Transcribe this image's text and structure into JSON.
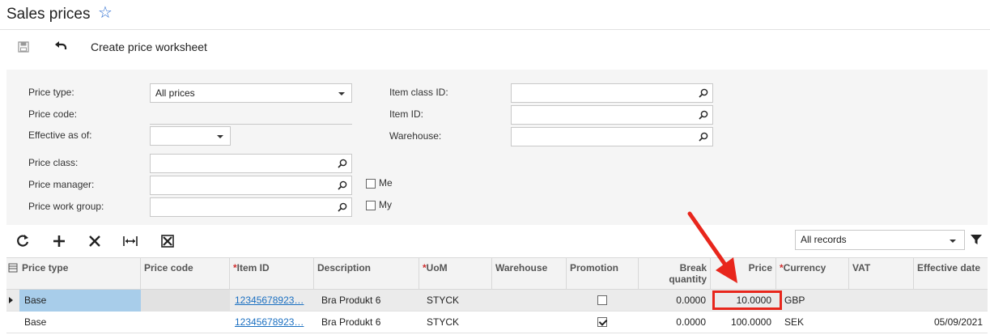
{
  "header": {
    "title": "Sales prices"
  },
  "toolbar": {
    "create_label": "Create price worksheet"
  },
  "filters": {
    "price_type_label": "Price type:",
    "price_type_value": "All prices",
    "price_code_label": "Price code:",
    "effective_label": "Effective as of:",
    "price_class_label": "Price class:",
    "price_manager_label": "Price manager:",
    "price_work_group_label": "Price work group:",
    "me_label": "Me",
    "my_label": "My",
    "item_class_label": "Item class ID:",
    "item_id_label": "Item ID:",
    "warehouse_label": "Warehouse:"
  },
  "gridbar": {
    "records_value": "All records"
  },
  "grid": {
    "columns": {
      "price_type": "Price type",
      "price_code": "Price code",
      "item_id": "Item ID",
      "description": "Description",
      "uom": "UoM",
      "warehouse": "Warehouse",
      "promotion": "Promotion",
      "break_qty": "Break quantity",
      "price": "Price",
      "currency": "Currency",
      "vat": "VAT",
      "effective": "Effective date"
    },
    "rows": [
      {
        "price_type": "Base",
        "price_code": "",
        "item_id": "12345678923…",
        "description": "Bra Produkt 6",
        "uom": "STYCK",
        "warehouse": "",
        "promotion": false,
        "break_qty": "0.0000",
        "price": "10.0000",
        "currency": "GBP",
        "vat": "",
        "effective": ""
      },
      {
        "price_type": "Base",
        "price_code": "",
        "item_id": "12345678923…",
        "description": "Bra Produkt 6",
        "uom": "STYCK",
        "warehouse": "",
        "promotion": true,
        "break_qty": "0.0000",
        "price": "100.0000",
        "currency": "SEK",
        "vat": "",
        "effective": "05/09/2021"
      }
    ]
  },
  "colors": {
    "accent": "#2f6fd0",
    "selected": "#a8cdea",
    "highlight": "#e8261c",
    "link": "#1a6fc1"
  },
  "icons": [
    "star-icon",
    "save-icon",
    "undo-icon",
    "search-icon",
    "refresh-icon",
    "add-icon",
    "delete-icon",
    "fit-columns-icon",
    "export-icon",
    "filter-icon"
  ]
}
